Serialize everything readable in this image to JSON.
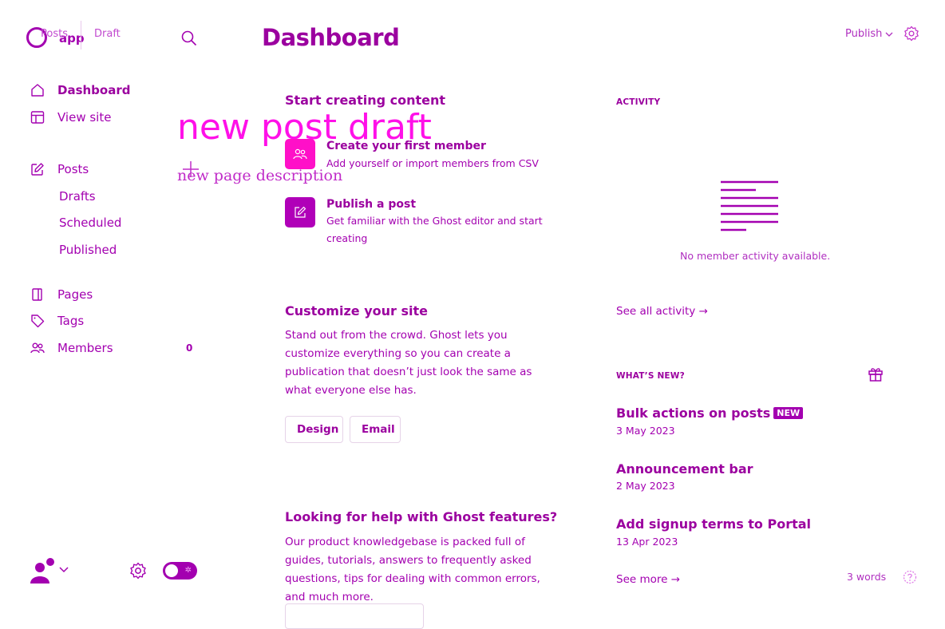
{
  "app": {
    "logo_text": "app"
  },
  "breadcrumbs": [
    "Posts",
    "Draft"
  ],
  "header": {
    "title": "Dashboard",
    "publish_label": "Publish"
  },
  "overlay": {
    "title": "new post draft",
    "description": "new page description"
  },
  "sidebar": {
    "items": [
      {
        "label": "Dashboard",
        "icon": "home-icon"
      },
      {
        "label": "View site",
        "icon": "layout-icon"
      },
      {
        "label": "Posts",
        "icon": "pencil-square-icon"
      },
      {
        "label": "Drafts"
      },
      {
        "label": "Scheduled"
      },
      {
        "label": "Published"
      },
      {
        "label": "Pages",
        "icon": "pages-icon"
      },
      {
        "label": "Tags",
        "icon": "tag-icon"
      },
      {
        "label": "Members",
        "icon": "members-icon",
        "count": "0"
      }
    ]
  },
  "main": {
    "start_title": "Start creating content",
    "cards": [
      {
        "title": "Create your first member",
        "desc": "Add yourself or import members from CSV",
        "icon": "members-icon",
        "color": "#ff10c8"
      },
      {
        "title": "Publish a post",
        "desc": "Get familiar with the Ghost editor and start creating",
        "icon": "edit-icon",
        "color": "#b000b8"
      }
    ],
    "customize_title": "Customize your site",
    "customize_text": "Stand out from the crowd. Ghost lets you customize everything so you can create a publication that doesn’t just look the same as what everyone else has.",
    "buttons": [
      "Design",
      "Email"
    ],
    "help_title": "Looking for help with Ghost features?",
    "help_text": "Our product knowledgebase is packed full of guides, tutorials, answers to frequently asked questions, tips for dealing with common errors, and much more."
  },
  "activity": {
    "heading": "ACTIVITY",
    "empty": "No member activity available.",
    "see_all": "See all activity →"
  },
  "whats_new": {
    "heading": "WHAT’S NEW?",
    "items": [
      {
        "title": "Bulk actions on posts",
        "badge": "NEW",
        "date": "3 May 2023"
      },
      {
        "title": "Announcement bar",
        "date": "2 May 2023"
      },
      {
        "title": "Add signup terms to Portal",
        "date": "13 Apr 2023"
      }
    ],
    "see_more": "See more →"
  },
  "footer": {
    "word_count": "3 words"
  },
  "colors": {
    "accent": "#a300b0",
    "pink": "#ff10e8"
  }
}
